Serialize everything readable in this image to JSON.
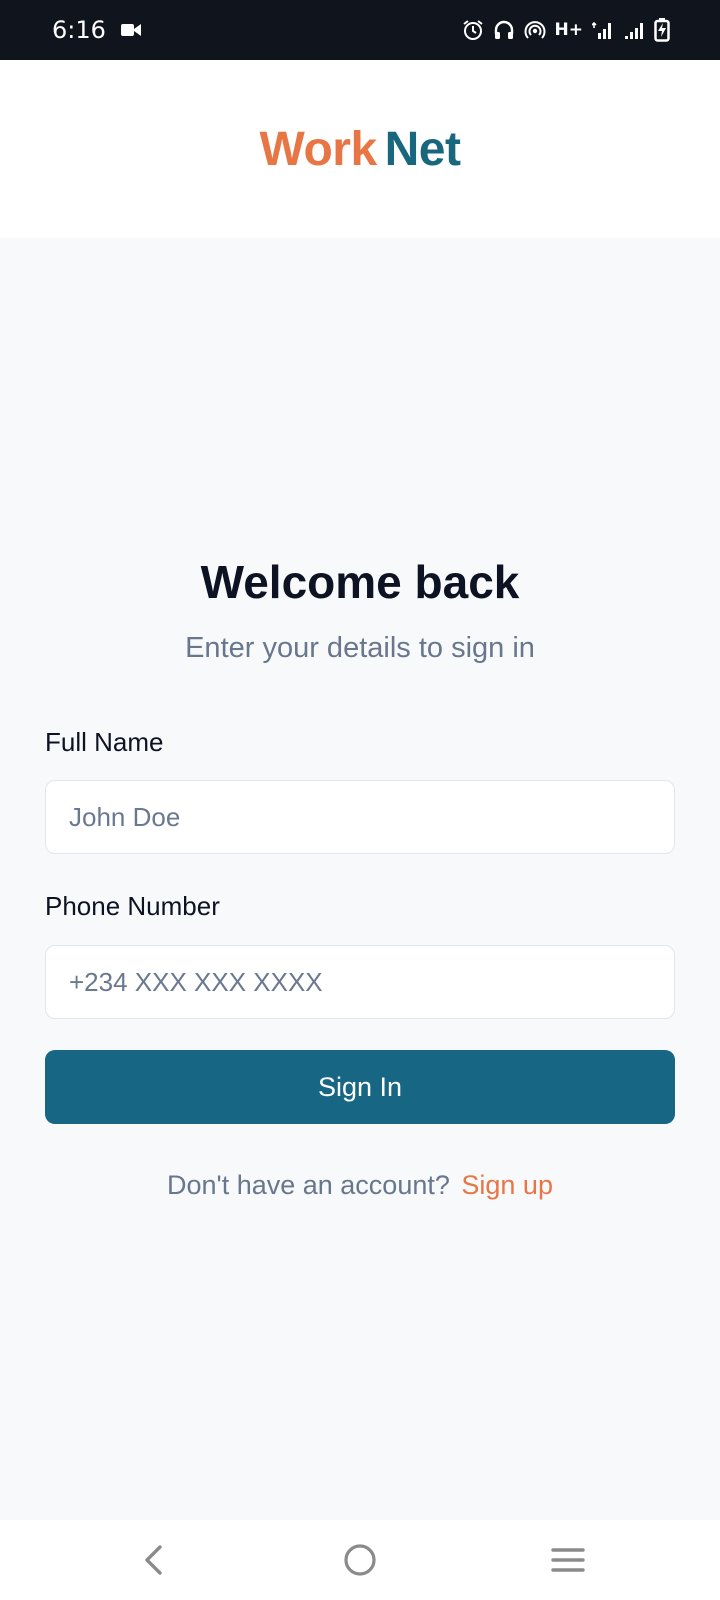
{
  "status_bar": {
    "time": "6:16",
    "network_type": "H+"
  },
  "header": {
    "logo_part1": "Work",
    "logo_part2": "Net"
  },
  "login": {
    "title": "Welcome back",
    "subtitle": "Enter your details to sign in",
    "name_label": "Full Name",
    "name_placeholder": "John Doe",
    "name_value": "",
    "phone_label": "Phone Number",
    "phone_placeholder": "+234 XXX XXX XXXX",
    "phone_value": "",
    "submit_label": "Sign In",
    "signup_prompt": "Don't have an account?",
    "signup_link": "Sign up"
  },
  "colors": {
    "brand_orange": "#e87645",
    "brand_teal": "#166684",
    "status_bar_bg": "#10141d",
    "page_bg": "#f8f9fb",
    "muted_text": "#68778d"
  }
}
